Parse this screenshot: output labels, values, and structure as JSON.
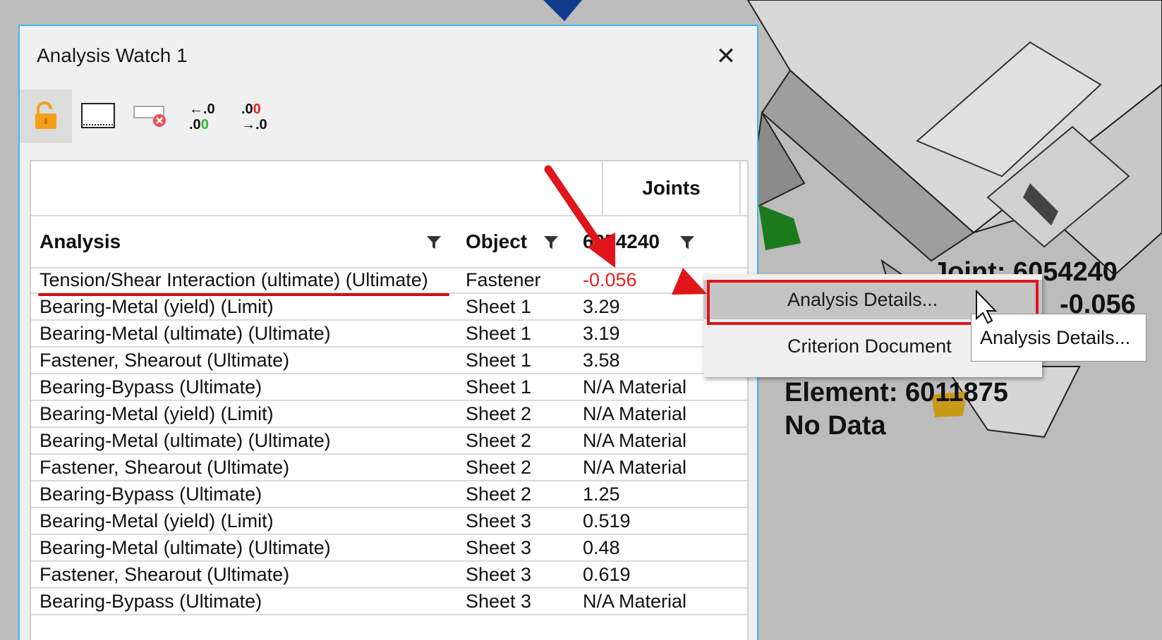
{
  "window": {
    "title": "Analysis Watch 1",
    "close_glyph": "✕"
  },
  "toolbar": {
    "buttons": [
      {
        "icon": "unlock-icon",
        "active": true
      },
      {
        "icon": "select-region-icon"
      },
      {
        "icon": "clear-icon"
      },
      {
        "icon": "decrease-decimals-icon",
        "text_top": "←.0",
        "text_bottom": ".00"
      },
      {
        "icon": "increase-decimals-icon",
        "text_top": ".00",
        "text_bottom": "→.0"
      }
    ]
  },
  "table": {
    "group_header": "Joints",
    "columns": {
      "analysis": "Analysis",
      "object": "Object",
      "joint_id": "6054240"
    },
    "rows": [
      {
        "analysis": "Tension/Shear Interaction (ultimate) (Ultimate)",
        "object": "Fastener",
        "value": "-0.056",
        "negative": true
      },
      {
        "analysis": "Bearing-Metal (yield) (Limit)",
        "object": "Sheet 1",
        "value": "3.29"
      },
      {
        "analysis": "Bearing-Metal (ultimate) (Ultimate)",
        "object": "Sheet 1",
        "value": "3.19"
      },
      {
        "analysis": "Fastener, Shearout (Ultimate)",
        "object": "Sheet 1",
        "value": "3.58"
      },
      {
        "analysis": "Bearing-Bypass (Ultimate)",
        "object": "Sheet 1",
        "value": "N/A Material"
      },
      {
        "analysis": "Bearing-Metal (yield) (Limit)",
        "object": "Sheet 2",
        "value": "N/A Material"
      },
      {
        "analysis": "Bearing-Metal (ultimate) (Ultimate)",
        "object": "Sheet 2",
        "value": "N/A Material"
      },
      {
        "analysis": "Fastener, Shearout (Ultimate)",
        "object": "Sheet 2",
        "value": "N/A Material"
      },
      {
        "analysis": "Bearing-Bypass (Ultimate)",
        "object": "Sheet 2",
        "value": "1.25"
      },
      {
        "analysis": "Bearing-Metal (yield) (Limit)",
        "object": "Sheet 3",
        "value": "0.519"
      },
      {
        "analysis": "Bearing-Metal (ultimate) (Ultimate)",
        "object": "Sheet 3",
        "value": "0.48"
      },
      {
        "analysis": "Fastener, Shearout (Ultimate)",
        "object": "Sheet 3",
        "value": "0.619"
      },
      {
        "analysis": "Bearing-Bypass (Ultimate)",
        "object": "Sheet 3",
        "value": "N/A Material"
      }
    ]
  },
  "context_menu": {
    "items": [
      {
        "label": "Analysis Details...",
        "highlighted": true
      },
      {
        "label": "Criterion Document"
      }
    ]
  },
  "tooltip": {
    "text": "Analysis Details..."
  },
  "viewport": {
    "joint_label": "Joint: 6054240",
    "joint_value": "-0.056",
    "element_label": "Element: 6011875",
    "element_status": "No Data"
  },
  "colors": {
    "accent_border": "#46b7e8",
    "annotation_red": "#e0141a",
    "negative_value": "#e8221a",
    "lock_orange": "#f5a01a"
  }
}
